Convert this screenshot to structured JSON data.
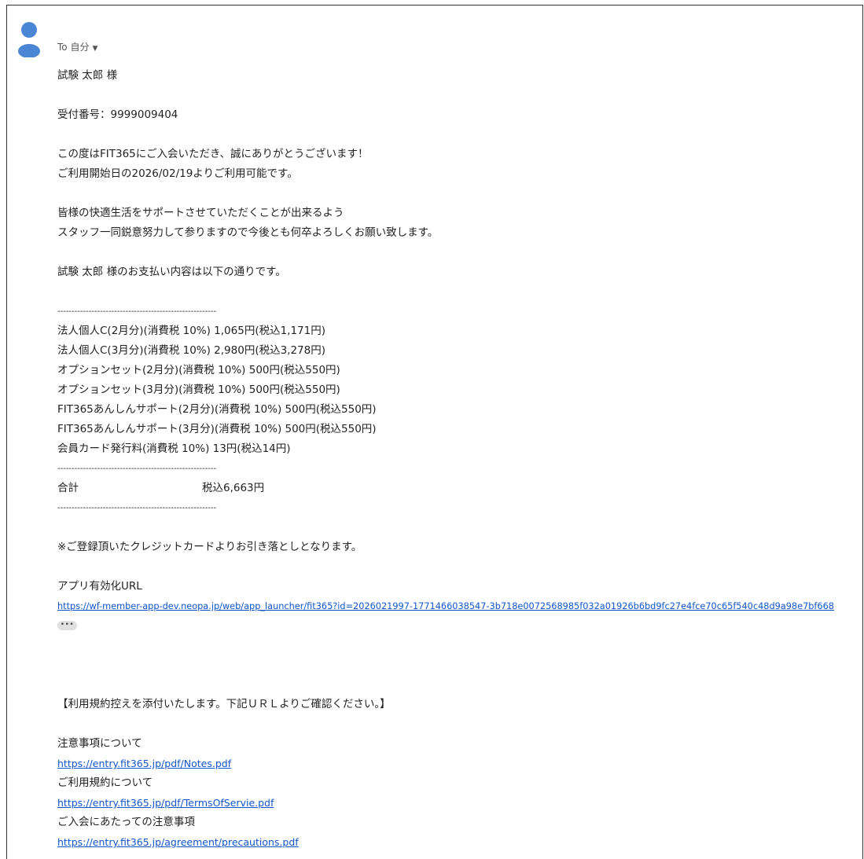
{
  "header": {
    "to_label": "To 自分",
    "dropdown_icon": "chevron-down-icon",
    "avatar_icon": "person-icon",
    "avatar_color": "#4a86d4"
  },
  "email": {
    "greeting": "試験 太郎 様",
    "receipt": "受付番号：9999009404",
    "intro": [
      "この度はFIT365にご入会いただき、誠にありがとうございます！",
      "ご利用開始日の2026/02/19よりご利用可能です。"
    ],
    "support": [
      "皆様の快適生活をサポートさせていただくことが出来るよう",
      "スタッフ一同鋭意努力して参りますので今後とも何卒よろしくお願い致します。"
    ],
    "payment_intro": "試験 太郎 様のお支払い内容は以下の通りです。",
    "separator": "--------------------------------------------------------",
    "items": [
      "法人個人C(2月分)(消費税 10%) 1,065円(税込1,171円)",
      "法人個人C(3月分)(消費税 10%) 2,980円(税込3,278円)",
      "オプションセット(2月分)(消費税 10%) 500円(税込550円)",
      "オプションセット(3月分)(消費税 10%) 500円(税込550円)",
      "FIT365あんしんサポート(2月分)(消費税 10%) 500円(税込550円)",
      "FIT365あんしんサポート(3月分)(消費税 10%) 500円(税込550円)",
      "会員カード発行料(消費税 10%) 13円(税込14円)"
    ],
    "total_label": "合計",
    "total_value": "税込6,663円",
    "card_note": "※ご登録頂いたクレジットカードよりお引き落としとなります。",
    "app_url_label": "アプリ有効化URL",
    "app_url": "https://wf-member-app-dev.neopa.jp/web/app_launcher/fit365?id=2026021997-1771466038547-3b718e0072568985f032a01926b6bd9fc27e4fce70c65f540c48d9a98e7bf668",
    "ellipsis": "•••",
    "terms_intro": "【利用規約控えを添付いたします。下記ＵＲＬよりご確認ください。】",
    "notes_label": "注意事項について",
    "notes_url": "https://entry.fit365.jp/pdf/Notes.pdf",
    "terms_label": "ご利用規約について",
    "terms_url": "https://entry.fit365.jp/pdf/TermsOfServie.pdf",
    "precautions_label": "ご入会にあたっての注意事項",
    "precautions_url": "https://entry.fit365.jp/agreement/precautions.pdf"
  }
}
